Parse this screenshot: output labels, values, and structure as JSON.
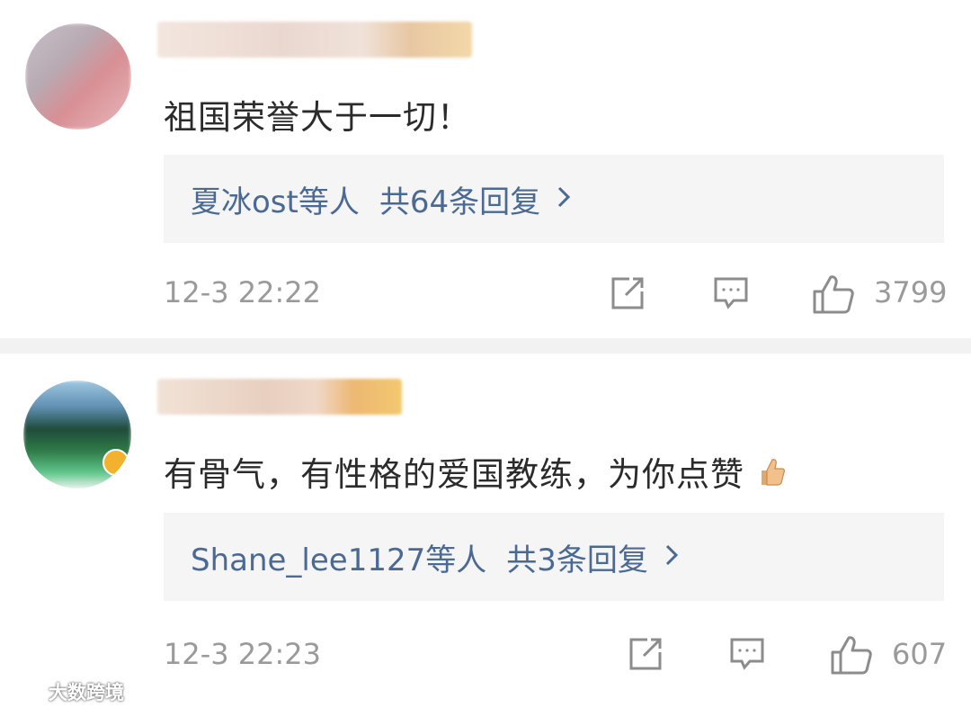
{
  "comments": [
    {
      "text": "祖国荣誉大于一切！",
      "reply_preview": {
        "names": "夏冰ost等人",
        "total": "共64条回复",
        "chevron": "›"
      },
      "time": "12-3 22:22",
      "likes": "3799",
      "icons": {
        "share": "share-icon",
        "reply": "comment-icon",
        "like": "thumbs-up-icon"
      }
    },
    {
      "text": "有骨气，有性格的爱国教练，为你点赞",
      "emoji": "thumbs-up-emoji",
      "reply_preview": {
        "names": "Shane_lee1127等人",
        "total": "共3条回复",
        "chevron": "›"
      },
      "time": "12-3 22:23",
      "likes": "607",
      "icons": {
        "share": "share-icon",
        "reply": "comment-icon",
        "like": "thumbs-up-icon"
      }
    }
  ],
  "watermark": {
    "text": "大数跨境"
  },
  "colors": {
    "link": "#4a6a95",
    "meta": "#9a9a9a",
    "reply_bg": "#f5f5f5",
    "page_bg": "#f4f4f4"
  }
}
